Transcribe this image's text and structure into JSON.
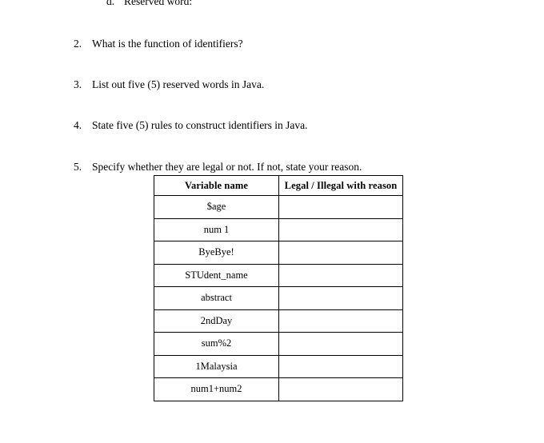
{
  "document": {
    "sub_item": {
      "marker": "d.",
      "text": "Reserved word:"
    },
    "questions": [
      {
        "marker": "2.",
        "text": "What is the function of identifiers?"
      },
      {
        "marker": "3.",
        "text": "List out five (5) reserved words in Java."
      },
      {
        "marker": "4.",
        "text": "State five (5) rules to construct identifiers in Java."
      },
      {
        "marker": "5.",
        "text": "Specify whether they are legal or not. If not, state your reason."
      }
    ],
    "table": {
      "headers": [
        "Variable name",
        "Legal / Illegal with reason"
      ],
      "rows": [
        {
          "variable_name": "$age",
          "reason": ""
        },
        {
          "variable_name": "num 1",
          "reason": ""
        },
        {
          "variable_name": "ByeBye!",
          "reason": ""
        },
        {
          "variable_name": "STUdent_name",
          "reason": ""
        },
        {
          "variable_name": "abstract",
          "reason": ""
        },
        {
          "variable_name": "2ndDay",
          "reason": ""
        },
        {
          "variable_name": "sum%2",
          "reason": ""
        },
        {
          "variable_name": "1Malaysia",
          "reason": ""
        },
        {
          "variable_name": "num1+num2",
          "reason": ""
        }
      ]
    }
  }
}
